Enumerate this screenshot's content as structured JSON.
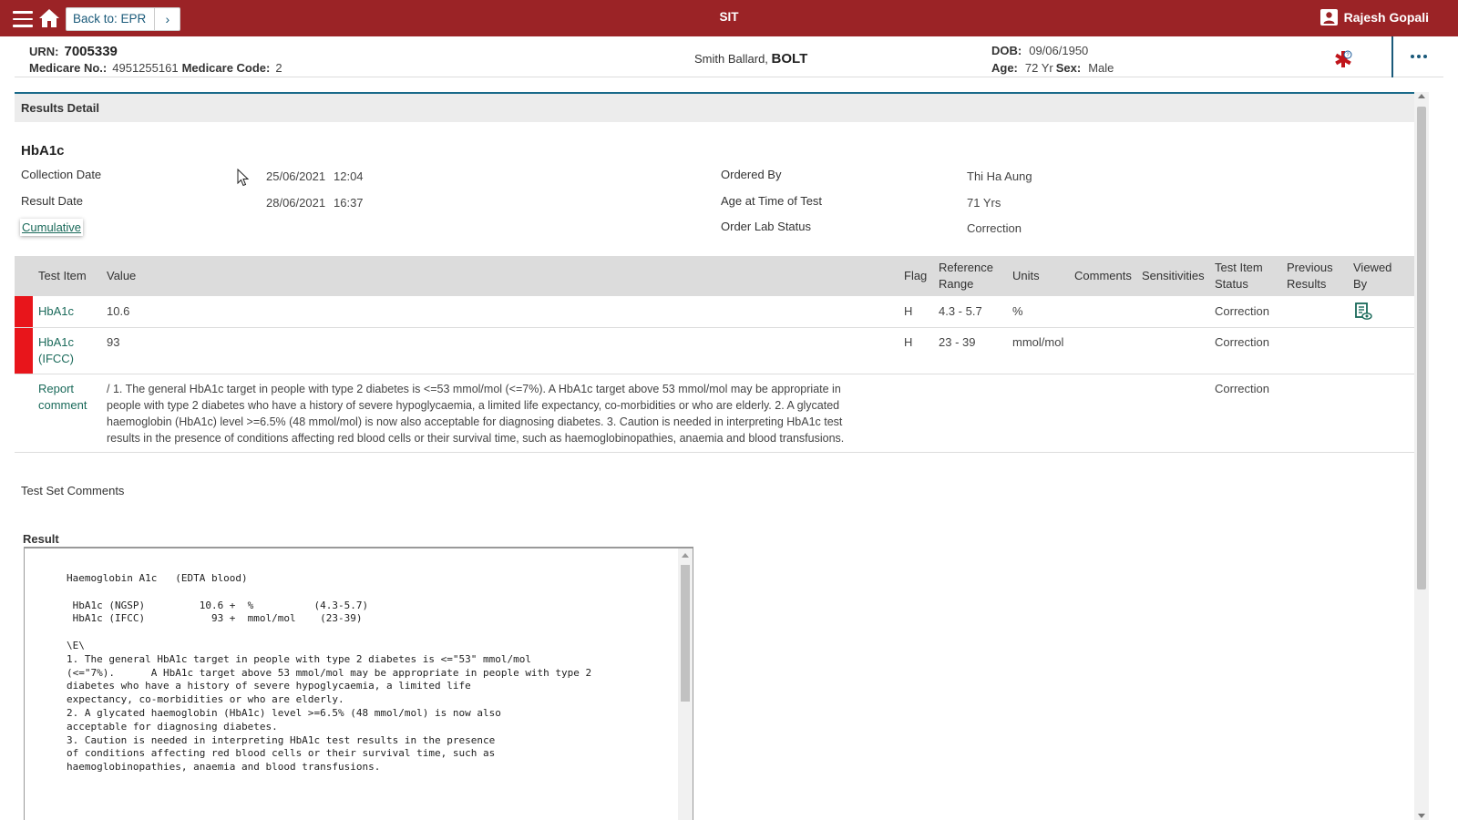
{
  "topbar": {
    "back_label": "Back to: EPR",
    "app_title": "SIT",
    "user_name": "Rajesh Gopali"
  },
  "banner": {
    "urn_label": "URN:",
    "urn": "7005339",
    "medicare_no_label": "Medicare No.:",
    "medicare_no": "4951255161",
    "medicare_code_label": "Medicare Code:",
    "medicare_code": "2",
    "given_names": "Smith Ballard,",
    "surname": "BOLT",
    "dob_label": "DOB:",
    "dob": "09/06/1950",
    "age_label": "Age:",
    "age": "72 Yr",
    "sex_label": "Sex:",
    "sex": "Male"
  },
  "results": {
    "section_title": "Results Detail",
    "test_name": "HbA1c",
    "collection_date_label": "Collection Date",
    "collection_date": "25/06/2021",
    "collection_time": "12:04",
    "result_date_label": "Result Date",
    "result_date": "28/06/2021",
    "result_time": "16:37",
    "cumulative_label": "Cumulative",
    "ordered_by_label": "Ordered By",
    "ordered_by": "Thi Ha Aung",
    "age_at_test_label": "Age at Time of Test",
    "age_at_test": "71 Yrs",
    "order_lab_status_label": "Order Lab Status",
    "order_lab_status": "Correction"
  },
  "table": {
    "headers": {
      "test_item": "Test Item",
      "value": "Value",
      "flag": "Flag",
      "reference_range_1": "Reference",
      "reference_range_2": "Range",
      "units": "Units",
      "comments": "Comments",
      "sensitivities": "Sensitivities",
      "test_item_status_1": "Test Item",
      "test_item_status_2": "Status",
      "previous_results_1": "Previous",
      "previous_results_2": "Results",
      "viewed_by_1": "Viewed",
      "viewed_by_2": "By"
    },
    "rows": [
      {
        "item": "HbA1c",
        "value": "10.6",
        "flag": "H",
        "range": "4.3 - 5.7",
        "units": "%",
        "status": "Correction",
        "viewed_icon": "document-view-icon"
      },
      {
        "item_1": "HbA1c",
        "item_2": "(IFCC)",
        "value": "93",
        "flag": "H",
        "range": "23 - 39",
        "units": "mmol/mol",
        "status": "Correction"
      },
      {
        "item_1": "Report",
        "item_2": "comment",
        "value_lines": [
          "/ 1. The general HbA1c target in people with type 2 diabetes is <=53 mmol/mol (<=7%). A HbA1c target above 53 mmol/mol may be appropriate in",
          "people with type 2 diabetes who have a history of severe hypoglycaemia, a limited life expectancy, co-morbidities or who are elderly. 2. A glycated",
          "haemoglobin (HbA1c) level >=6.5% (48 mmol/mol) is now also acceptable for diagnosing diabetes. 3. Caution is needed in interpreting HbA1c test",
          "results in the presence of conditions affecting red blood cells or their survival time, such as haemoglobinopathies, anaemia and blood transfusions."
        ],
        "status": "Correction"
      }
    ]
  },
  "test_set_comments_label": "Test Set Comments",
  "result_label": "Result",
  "result_text": "Haemoglobin A1c   (EDTA blood)\n\n HbA1c (NGSP)         10.6 +  %          (4.3-5.7)\n HbA1c (IFCC)           93 +  mmol/mol    (23-39)\n\n\\E\\\n1. The general HbA1c target in people with type 2 diabetes is <=\"53\" mmol/mol\n(<=\"7%).      A HbA1c target above 53 mmol/mol may be appropriate in people with type 2\ndiabetes who have a history of severe hypoglycaemia, a limited life\nexpectancy, co-morbidities or who are elderly.\n2. A glycated haemoglobin (HbA1c) level >=6.5% (48 mmol/mol) is now also\nacceptable for diagnosing diabetes.\n3. Caution is needed in interpreting HbA1c test results in the presence\nof conditions affecting red blood cells or their survival time, such as\nhaemoglobinopathies, anaemia and blood transfusions.",
  "colors": {
    "topbar": "#9b2326",
    "flag_red": "#e8151b",
    "link_green": "#1a6a5a",
    "accent_blue": "#1a6a8a"
  }
}
